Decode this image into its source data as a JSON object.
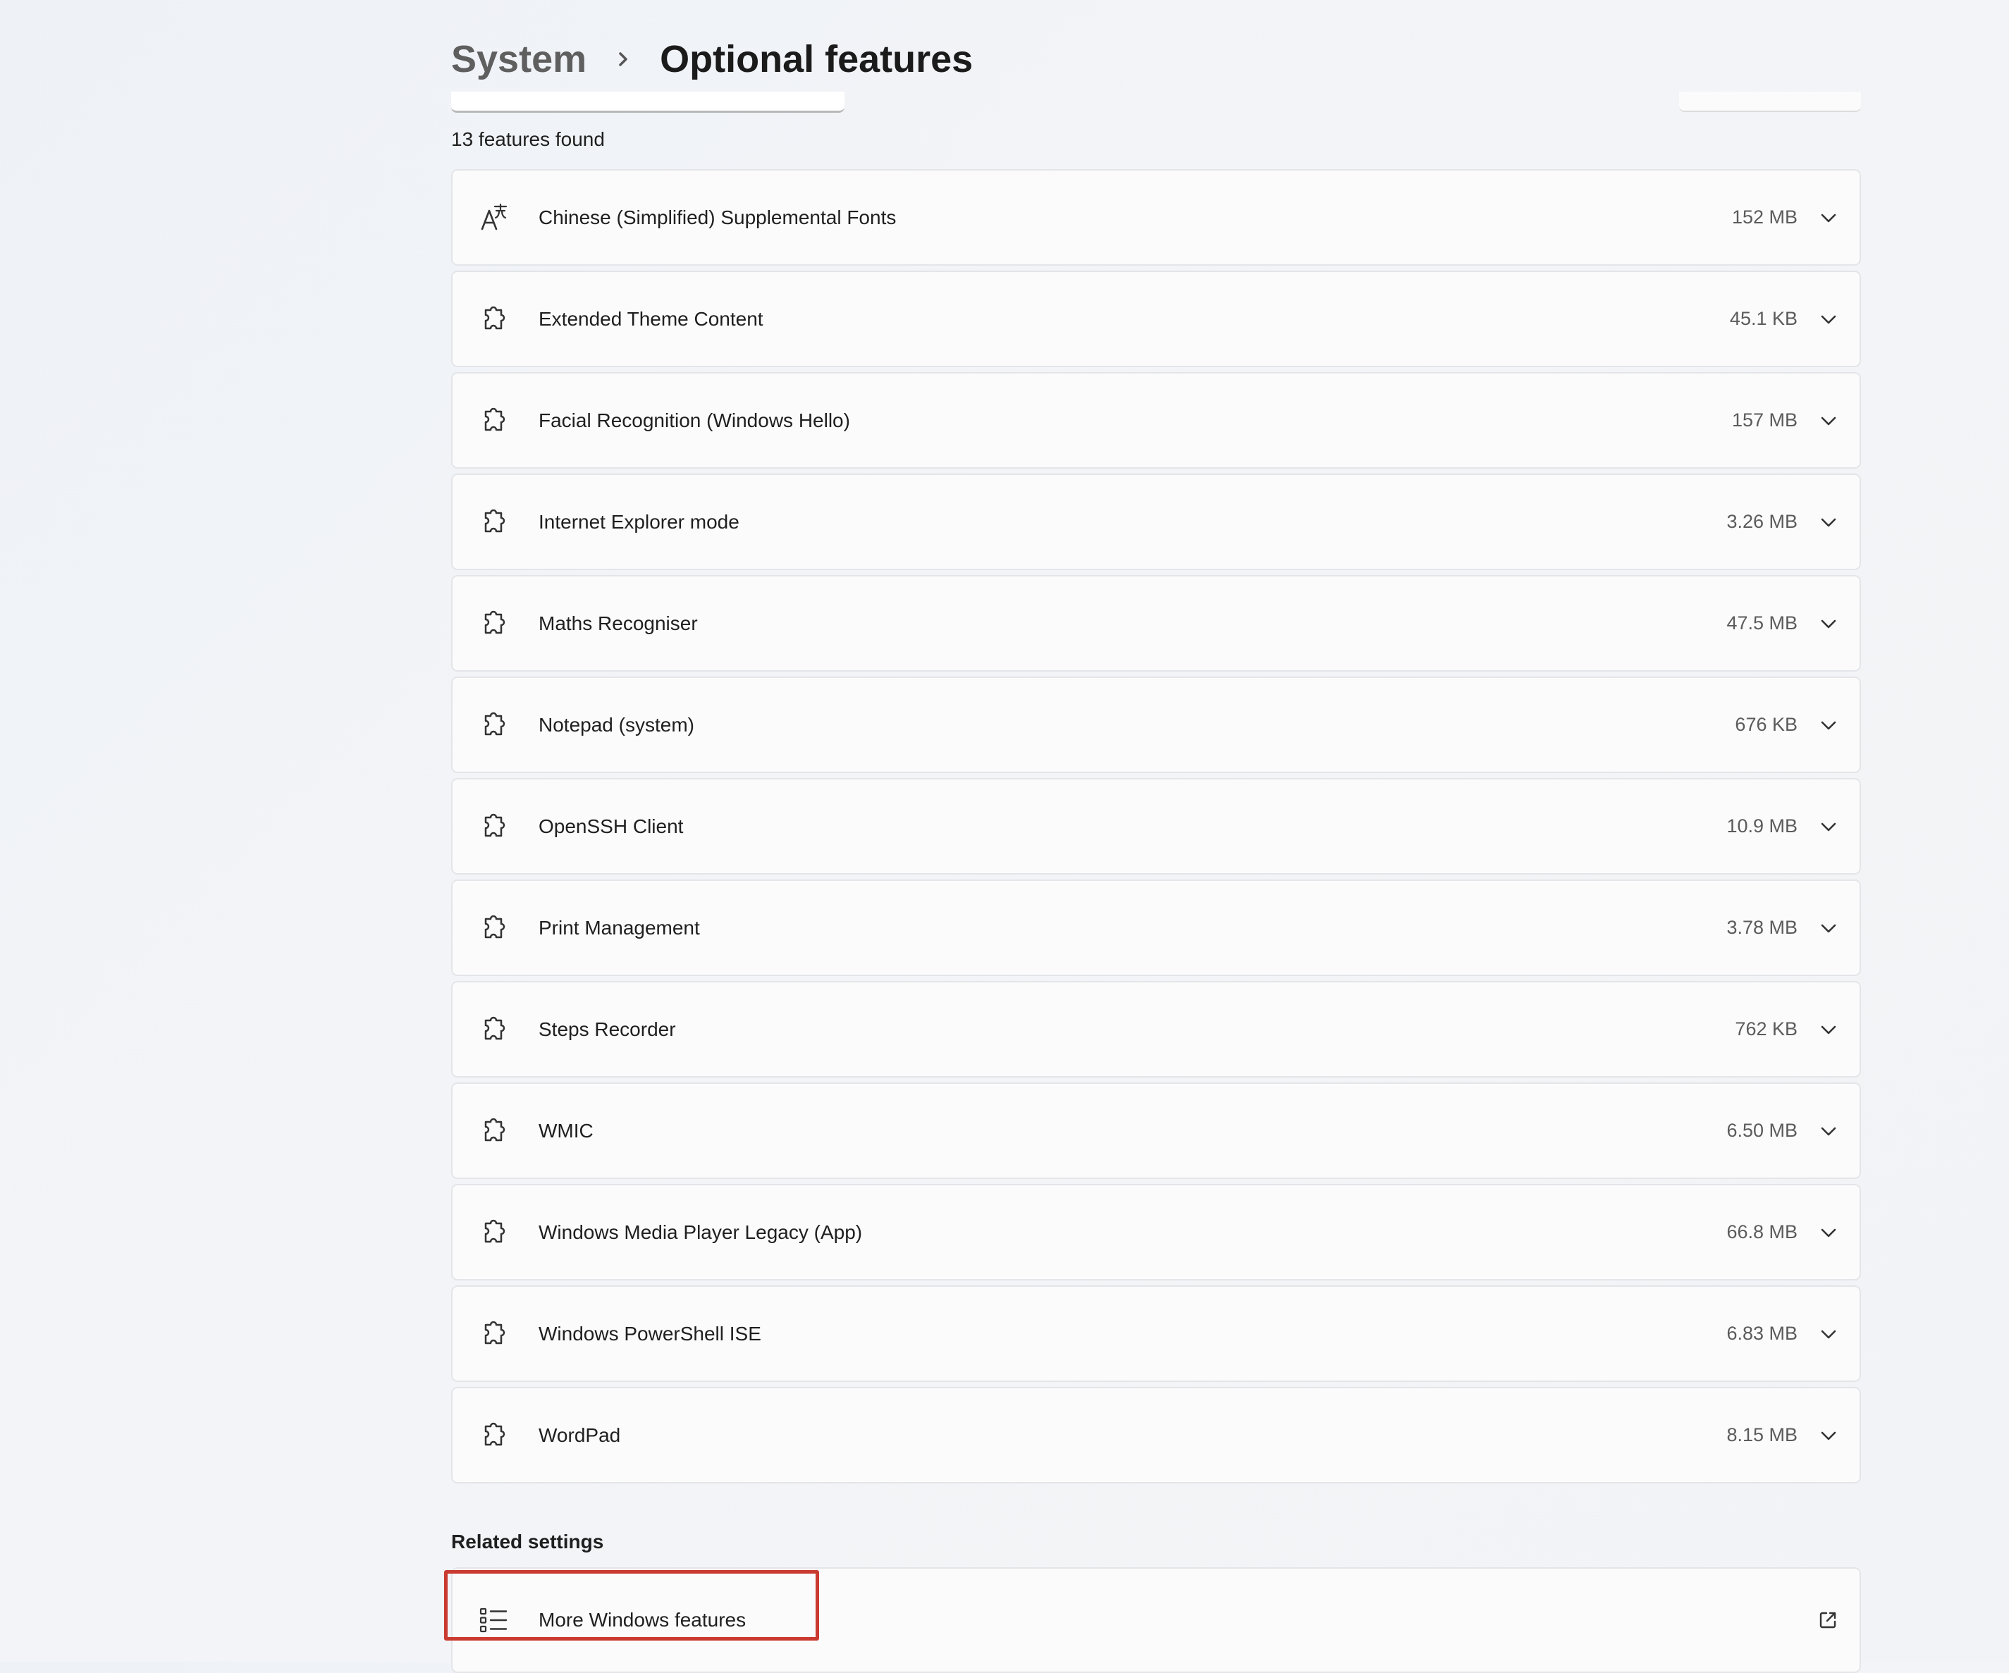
{
  "breadcrumb": {
    "parent": "System",
    "current": "Optional features"
  },
  "features": {
    "count_text": "13 features found",
    "items": [
      {
        "label": "Chinese (Simplified) Supplemental Fonts",
        "size": "152 MB",
        "icon": "font-icon"
      },
      {
        "label": "Extended Theme Content",
        "size": "45.1 KB",
        "icon": "puzzle-icon"
      },
      {
        "label": "Facial Recognition (Windows Hello)",
        "size": "157 MB",
        "icon": "puzzle-icon"
      },
      {
        "label": "Internet Explorer mode",
        "size": "3.26 MB",
        "icon": "puzzle-icon"
      },
      {
        "label": "Maths Recogniser",
        "size": "47.5 MB",
        "icon": "puzzle-icon"
      },
      {
        "label": "Notepad (system)",
        "size": "676 KB",
        "icon": "puzzle-icon"
      },
      {
        "label": "OpenSSH Client",
        "size": "10.9 MB",
        "icon": "puzzle-icon"
      },
      {
        "label": "Print Management",
        "size": "3.78 MB",
        "icon": "puzzle-icon"
      },
      {
        "label": "Steps Recorder",
        "size": "762 KB",
        "icon": "puzzle-icon"
      },
      {
        "label": "WMIC",
        "size": "6.50 MB",
        "icon": "puzzle-icon"
      },
      {
        "label": "Windows Media Player Legacy (App)",
        "size": "66.8 MB",
        "icon": "puzzle-icon"
      },
      {
        "label": "Windows PowerShell ISE",
        "size": "6.83 MB",
        "icon": "puzzle-icon"
      },
      {
        "label": "WordPad",
        "size": "8.15 MB",
        "icon": "puzzle-icon"
      }
    ]
  },
  "related": {
    "heading": "Related settings",
    "items": [
      {
        "label": "More Windows features",
        "icon": "list-icon",
        "action_icon": "open-external-icon"
      }
    ]
  },
  "colors": {
    "highlight_border": "#c93a30",
    "card_background": "#fbfbfc",
    "card_border": "#e4e5e8",
    "page_background": "#f1f3f6"
  }
}
